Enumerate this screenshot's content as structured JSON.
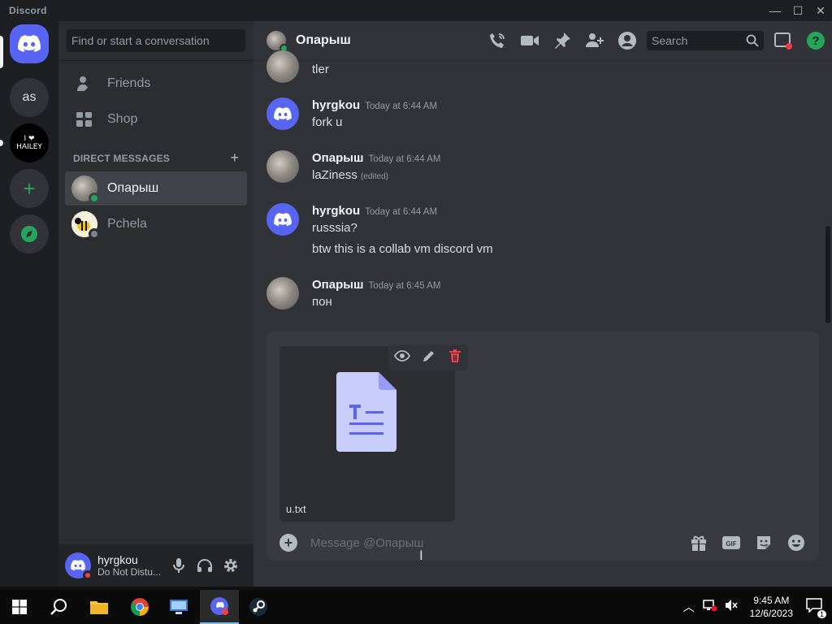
{
  "window": {
    "title": "Discord"
  },
  "servers": [
    {
      "label": "as"
    },
    {
      "label": "I ❤ HAILEY"
    }
  ],
  "dm_sidebar": {
    "search_placeholder": "Find or start a conversation",
    "nav": [
      {
        "label": "Friends"
      },
      {
        "label": "Shop"
      }
    ],
    "section_title": "DIRECT MESSAGES",
    "dms": [
      {
        "name": "Опарыш",
        "status": "online",
        "active": true
      },
      {
        "name": "Pchela",
        "status": "offline",
        "active": false
      }
    ]
  },
  "user_panel": {
    "username": "hyrgkou",
    "status": "Do Not Distu..."
  },
  "chat": {
    "recipient": "Опарыш",
    "search_placeholder": "Search",
    "messages": [
      {
        "author": "",
        "time": "",
        "lines": [
          "tler"
        ]
      },
      {
        "author": "hyrgkou",
        "time": "Today at 6:44 AM",
        "lines": [
          "fork u"
        ]
      },
      {
        "author": "Опарыш",
        "time": "Today at 6:44 AM",
        "lines": [
          "laZiness"
        ],
        "edited": "(edited)"
      },
      {
        "author": "hyrgkou",
        "time": "Today at 6:44 AM",
        "lines": [
          "russsia?",
          "btw this is a collab vm discord vm"
        ]
      },
      {
        "author": "Опарыш",
        "time": "Today at 6:45 AM",
        "lines": [
          "пон"
        ]
      }
    ],
    "attachment": {
      "filename": "u.txt"
    },
    "composer_placeholder": "Message @Опарыш"
  },
  "taskbar": {
    "time": "9:45 AM",
    "date": "12/6/2023",
    "notification_count": "1"
  },
  "colors": {
    "blurple": "#5865f2",
    "green": "#23a55a",
    "red": "#f23f43",
    "dnd": "#f23f43"
  }
}
